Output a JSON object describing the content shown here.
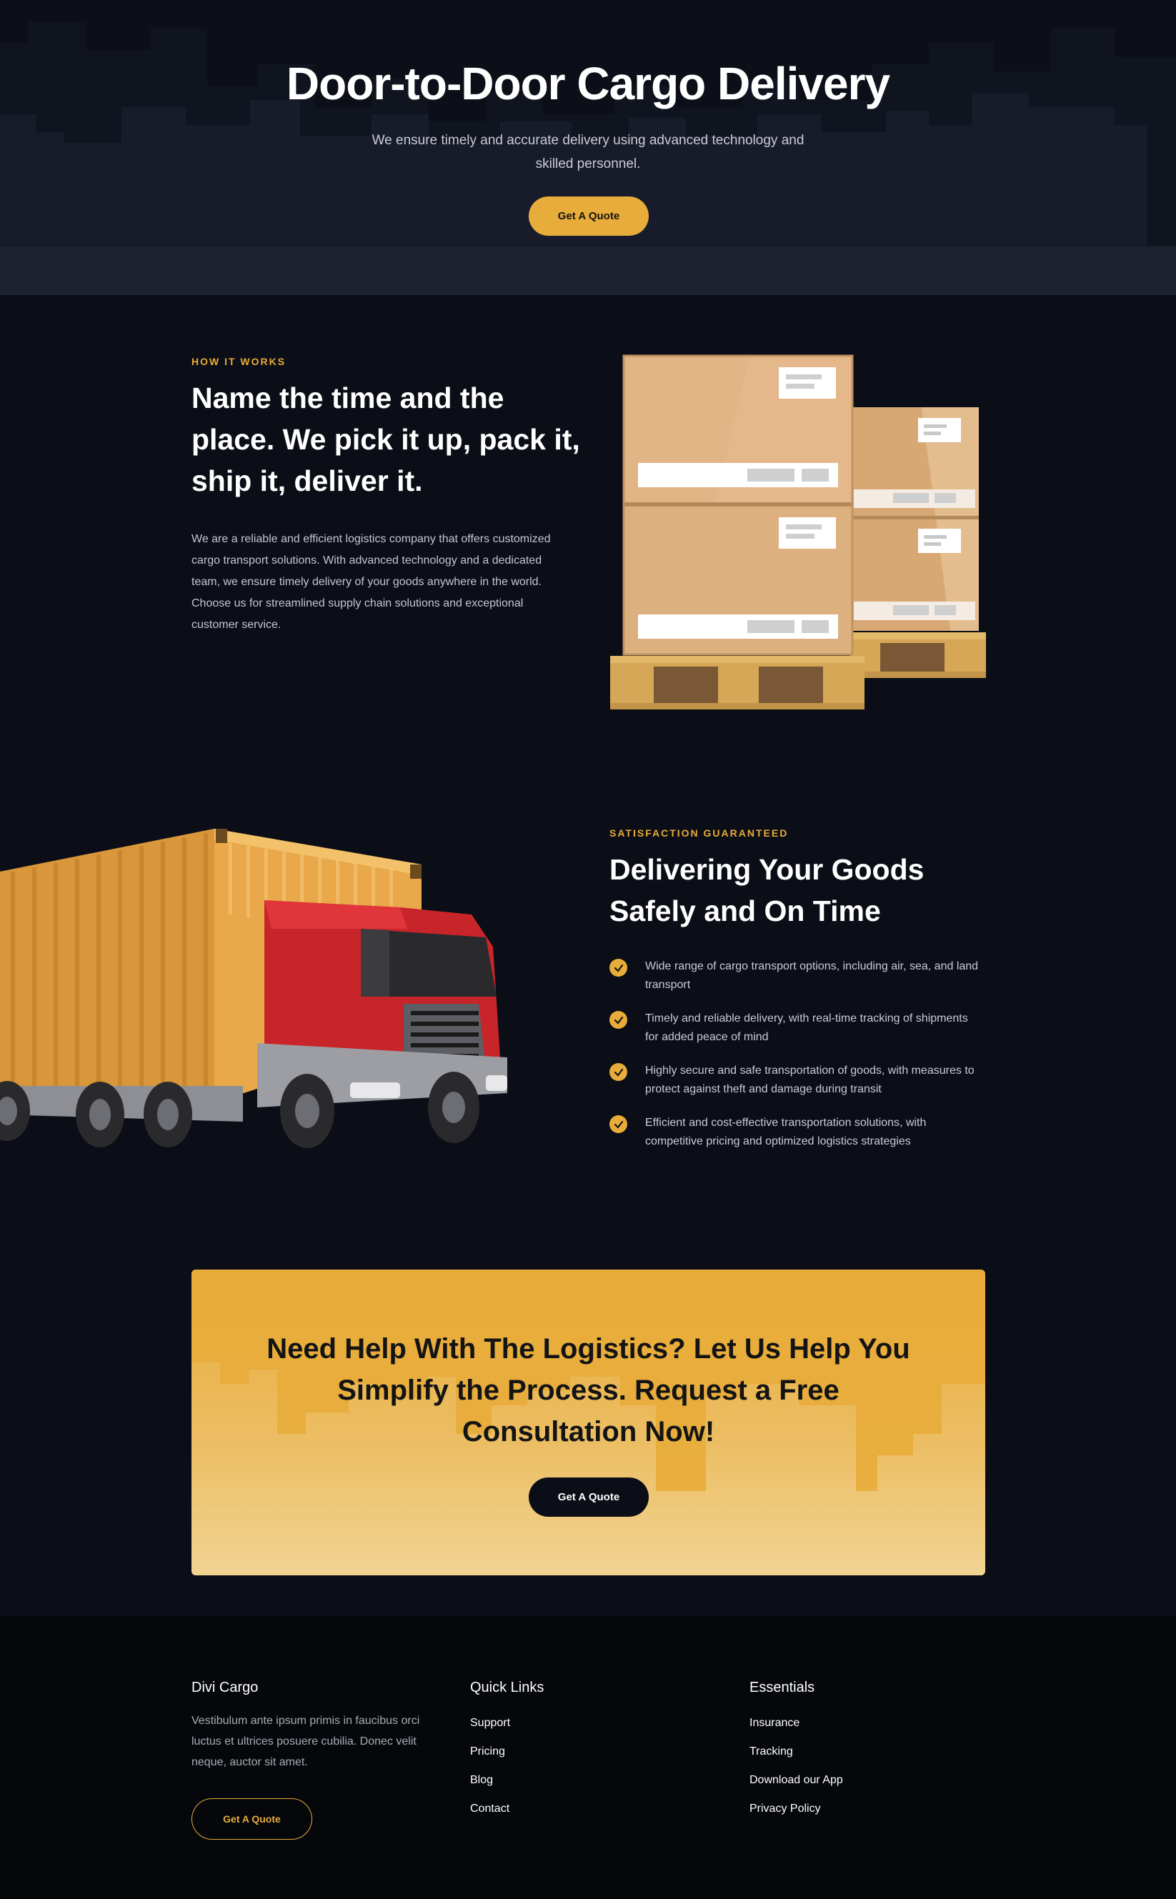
{
  "hero": {
    "title": "Door-to-Door Cargo Delivery",
    "subtitle": "We ensure timely and accurate delivery using advanced technology and skilled personnel.",
    "cta_label": "Get A Quote"
  },
  "how_it_works": {
    "eyebrow": "HOW IT WORKS",
    "heading": "Name the time and the place. We pick it up, pack it, ship it, deliver it.",
    "body": "We are a reliable and efficient logistics company that offers customized cargo transport solutions. With advanced technology and a dedicated team, we ensure timely delivery of your goods anywhere in the world. Choose us for streamlined supply chain solutions and exceptional customer service."
  },
  "satisfaction": {
    "eyebrow": "SATISFACTION GUARANTEED",
    "heading": "Delivering Your Goods Safely and On Time",
    "features": [
      "Wide range of cargo transport options, including air, sea, and land transport",
      "Timely and reliable delivery, with real-time tracking of shipments for added peace of mind",
      "Highly secure and safe transportation of goods, with measures to protect against theft and damage during transit",
      "Efficient and cost-effective transportation solutions, with competitive pricing and optimized logistics strategies"
    ]
  },
  "cta": {
    "title": "Need Help With The Logistics? Let Us Help You Simplify the Process. Request a Free Consultation Now!",
    "button_label": "Get A Quote"
  },
  "footer": {
    "brand": {
      "title": "Divi Cargo",
      "text": "Vestibulum ante ipsum primis in faucibus orci luctus et ultrices posuere cubilia. Donec velit neque, auctor sit amet.",
      "button_label": "Get A Quote"
    },
    "quick_links": {
      "title": "Quick Links",
      "items": [
        "Support",
        "Pricing",
        "Blog",
        "Contact"
      ]
    },
    "essentials": {
      "title": "Essentials",
      "items": [
        "Insurance",
        "Tracking",
        "Download our App",
        "Privacy Policy"
      ]
    }
  },
  "colors": {
    "accent": "#e8ac3a",
    "background": "#0b0e16",
    "footer": "#05070b"
  }
}
